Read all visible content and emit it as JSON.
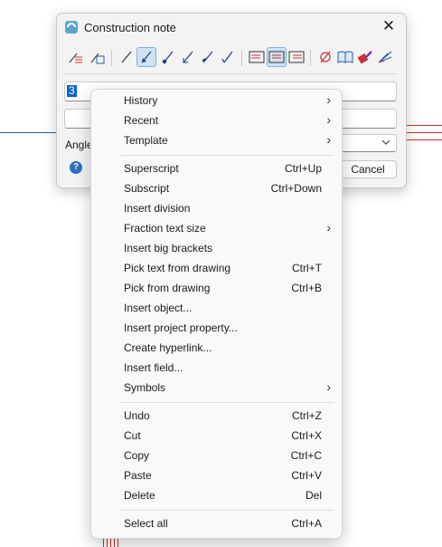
{
  "dialog": {
    "title": "Construction note",
    "cancel_label": "Cancel",
    "angle_label": "Angle",
    "text_field_value": "3",
    "help_symbol": "?"
  },
  "toolbar": {
    "icons": [
      "text-align-left-icon",
      "text-align-right-icon",
      "line-icon",
      "leader-arrow-icon",
      "leader-dot-icon",
      "leader-open-arrow-icon",
      "leader-slash-icon",
      "leader-tick-icon",
      "frame-left-icon",
      "frame-center-icon",
      "frame-right-icon",
      "diameter-icon",
      "book-icon",
      "color-brush-icon",
      "hatch-icon"
    ]
  },
  "context_menu": {
    "items": [
      {
        "label": "History",
        "shortcut": "",
        "submenu": true
      },
      {
        "label": "Recent",
        "shortcut": "",
        "submenu": true
      },
      {
        "label": "Template",
        "shortcut": "",
        "submenu": true
      },
      {
        "label": "Superscript",
        "shortcut": "Ctrl+Up",
        "submenu": false
      },
      {
        "label": "Subscript",
        "shortcut": "Ctrl+Down",
        "submenu": false
      },
      {
        "label": "Insert division",
        "shortcut": "",
        "submenu": false
      },
      {
        "label": "Fraction text size",
        "shortcut": "",
        "submenu": true
      },
      {
        "label": "Insert big brackets",
        "shortcut": "",
        "submenu": false
      },
      {
        "label": "Pick text from drawing",
        "shortcut": "Ctrl+T",
        "submenu": false
      },
      {
        "label": "Pick from drawing",
        "shortcut": "Ctrl+B",
        "submenu": false
      },
      {
        "label": "Insert object...",
        "shortcut": "",
        "submenu": false
      },
      {
        "label": "Insert project property...",
        "shortcut": "",
        "submenu": false
      },
      {
        "label": "Create hyperlink...",
        "shortcut": "",
        "submenu": false
      },
      {
        "label": "Insert field...",
        "shortcut": "",
        "submenu": false
      },
      {
        "label": "Symbols",
        "shortcut": "",
        "submenu": true
      },
      {
        "label": "Undo",
        "shortcut": "Ctrl+Z",
        "submenu": false
      },
      {
        "label": "Cut",
        "shortcut": "Ctrl+X",
        "submenu": false
      },
      {
        "label": "Copy",
        "shortcut": "Ctrl+C",
        "submenu": false
      },
      {
        "label": "Paste",
        "shortcut": "Ctrl+V",
        "submenu": false
      },
      {
        "label": "Delete",
        "shortcut": "Del",
        "submenu": false
      },
      {
        "label": "Select all",
        "shortcut": "Ctrl+A",
        "submenu": false
      }
    ],
    "submenu_arrow": "›"
  },
  "colors": {
    "selection": "#0a64c8",
    "drawing_red": "#d0312d",
    "drawing_blue": "#2a5db0",
    "active_tool": "#cfe3f6"
  }
}
